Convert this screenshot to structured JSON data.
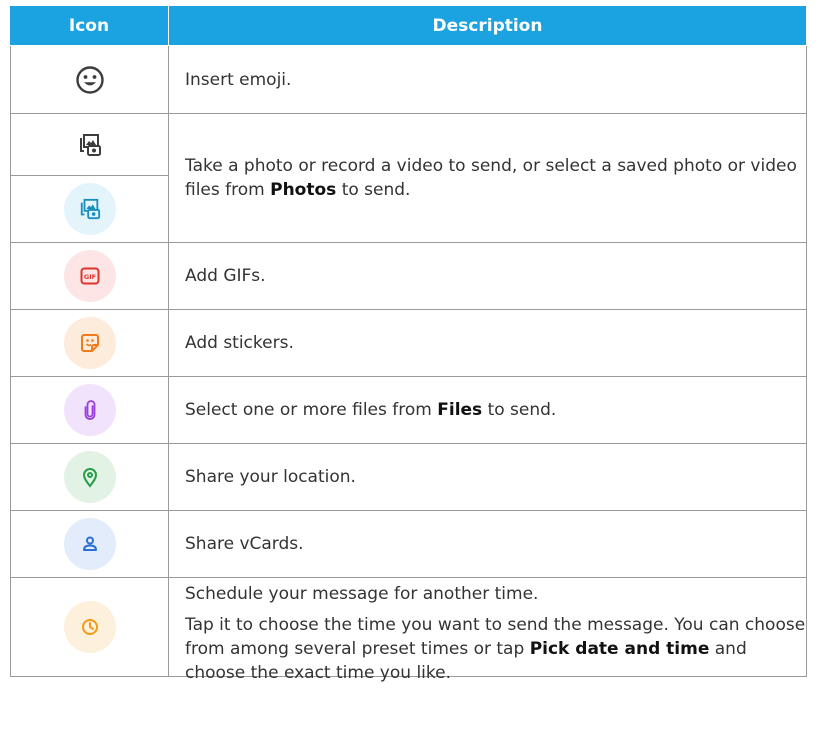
{
  "header": {
    "icon": "Icon",
    "description": "Description"
  },
  "colors": {
    "header_bg": "#1aa3e0",
    "photo_bg": "#e3f4fb",
    "photo_fg": "#1a8fbf",
    "gif_bg": "#fde5e5",
    "gif_fg": "#e0322f",
    "sticker_bg": "#fdebdc",
    "sticker_fg": "#f07b1d",
    "file_bg": "#f1e3fb",
    "file_fg": "#9a3fe0",
    "location_bg": "#e2f3e6",
    "location_fg": "#2a9d49",
    "vcard_bg": "#e2ecfb",
    "vcard_fg": "#2a6fd6",
    "schedule_bg": "#fdf0dc",
    "schedule_fg": "#f59a18"
  },
  "rows": [
    {
      "icon": "emoji-icon",
      "text": "Insert emoji."
    },
    {
      "icon": "photo-icon",
      "icon2": "photo-icon-colored",
      "text_pre": "Take a photo or record a video to send, or select a saved photo or video files from ",
      "text_bold": "Photos",
      "text_post": " to send."
    },
    {
      "icon": "gif-icon",
      "text": "Add GIFs.",
      "icon_text": "GIF"
    },
    {
      "icon": "sticker-icon",
      "text": "Add stickers."
    },
    {
      "icon": "attachment-icon",
      "text_pre": "Select one or more files from ",
      "text_bold": "Files",
      "text_post": " to send."
    },
    {
      "icon": "location-icon",
      "text": "Share your location."
    },
    {
      "icon": "contact-icon",
      "text": "Share vCards."
    },
    {
      "icon": "schedule-icon",
      "para1": "Schedule your message for another time.",
      "para2_pre": "Tap it to choose the time you want to send the message. You can choose from among several preset times or tap ",
      "para2_bold": "Pick date and time",
      "para2_post": " and choose the exact time you like."
    }
  ]
}
